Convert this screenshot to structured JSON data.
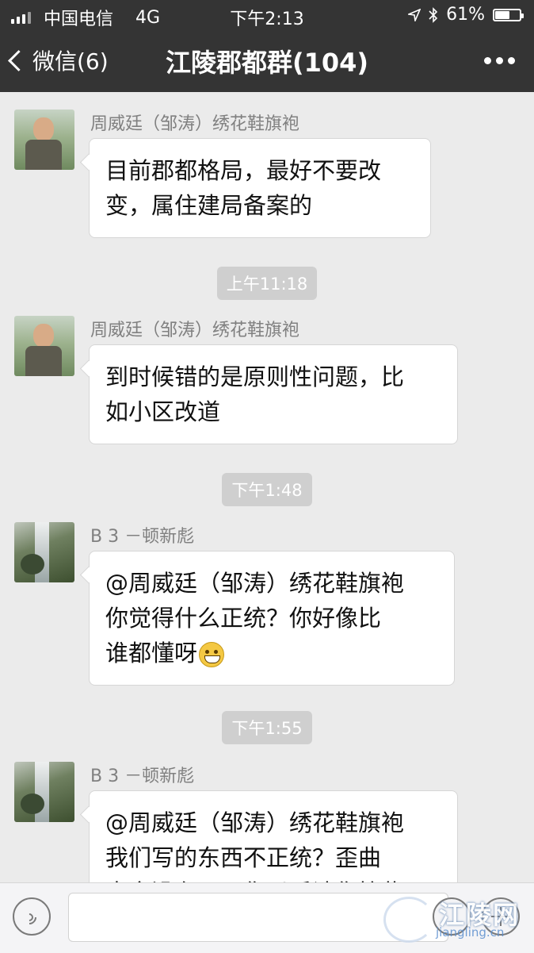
{
  "status_bar": {
    "carrier": "中国电信",
    "network": "4G",
    "time": "下午2:13",
    "battery_percent": "61%",
    "battery_level": 0.61
  },
  "nav": {
    "back_label": "微信(6)",
    "title": "江陵郡都群(104)"
  },
  "messages": [
    {
      "sender": "周威廷（邹涛）绣花鞋旗袍",
      "lines": [
        "目前郡都格局，最好不要改",
        "变，属住建局备案的"
      ]
    },
    {
      "sender": "周威廷（邹涛）绣花鞋旗袍",
      "lines": [
        "到时候错的是原则性问题，比",
        "如小区改道"
      ]
    },
    {
      "sender": "B 3 －顿新彪",
      "lines": [
        "@周威廷（邹涛）绣花鞋旗袍",
        " 你觉得什么正统？你好像比",
        "谁都懂呀"
      ],
      "emoji": "grin-emoji"
    },
    {
      "sender": "B 3 －顿新彪",
      "lines": [
        "@周威廷（邹涛）绣花鞋旗袍",
        " 我们写的东西不正统？歪曲",
        "事实没有？那你以后请你搞些"
      ]
    }
  ],
  "timestamps": [
    "上午11:18",
    "下午1:48",
    "下午1:55"
  ],
  "watermark": {
    "name": "江陵网",
    "url": "jiangling.cn"
  },
  "colors": {
    "header_bg": "#343434",
    "chat_bg": "#ebebeb",
    "bubble_bg": "#ffffff",
    "timestamp_bg": "#cfcfcf"
  },
  "icons": [
    "back-chevron-icon",
    "more-dots-icon",
    "voice-icon",
    "emoji-icon",
    "plus-icon",
    "location-arrow-icon",
    "bluetooth-icon",
    "battery-icon",
    "signal-icon"
  ]
}
